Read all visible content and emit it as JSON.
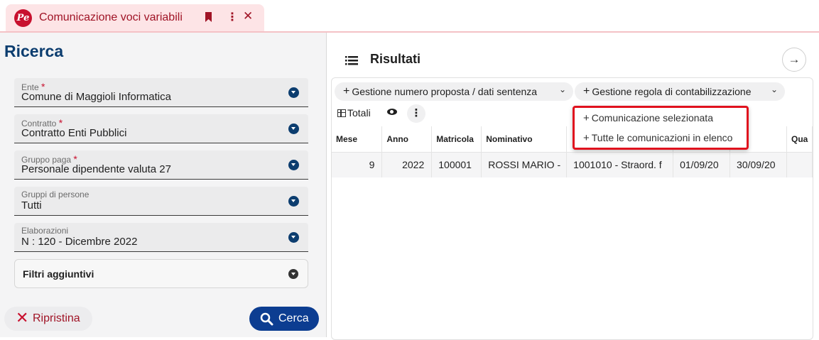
{
  "tab": {
    "logo_text": "Pe",
    "title": "Comunicazione voci variabili",
    "bookmark_icon": "bookmark-icon",
    "more_symbol": "⋮",
    "close_symbol": "✕"
  },
  "search_panel": {
    "title": "Ricerca",
    "required_mark": "*",
    "fields": [
      {
        "label": "Ente",
        "required": true,
        "value": "Comune di Maggioli Informatica"
      },
      {
        "label": "Contratto",
        "required": true,
        "value": "Contratto Enti Pubblici"
      },
      {
        "label": "Gruppo paga",
        "required": true,
        "value": "Personale dipendente valuta 27"
      },
      {
        "label": "Gruppi di persone",
        "required": false,
        "value": "Tutti"
      },
      {
        "label": "Elaborazioni",
        "required": false,
        "value": "N : 120 - Dicembre 2022"
      }
    ],
    "filters_label": "Filtri aggiuntivi",
    "reset_label": "Ripristina",
    "search_label": "Cerca"
  },
  "results": {
    "title": "Risultati",
    "arrow_symbol": "→",
    "toolbar": {
      "btn1_label": "Gestione numero proposta / dati sentenza",
      "btn2_label": "Gestione regola di contabilizzazione",
      "plus_symbol": "+",
      "chevron_symbol": "⌄",
      "totals_label": "Totali",
      "kebab_symbol": "⋮"
    },
    "table": {
      "columns": [
        "Mese",
        "Anno",
        "Matricola",
        "Nominativo",
        "",
        "",
        "",
        "Qua"
      ],
      "rows": [
        [
          "9",
          "2022",
          "100001",
          "ROSSI MARIO -",
          "1001010 - Straord. f",
          "01/09/20",
          "30/09/20",
          ""
        ]
      ]
    },
    "popup_menu": {
      "items": [
        "Comunicazione selezionata",
        "Tutte le comunicazioni in elenco"
      ]
    }
  },
  "colors": {
    "brand_red": "#c8102e",
    "primary_blue": "#0c3d91",
    "highlight_border": "#e0121e"
  }
}
